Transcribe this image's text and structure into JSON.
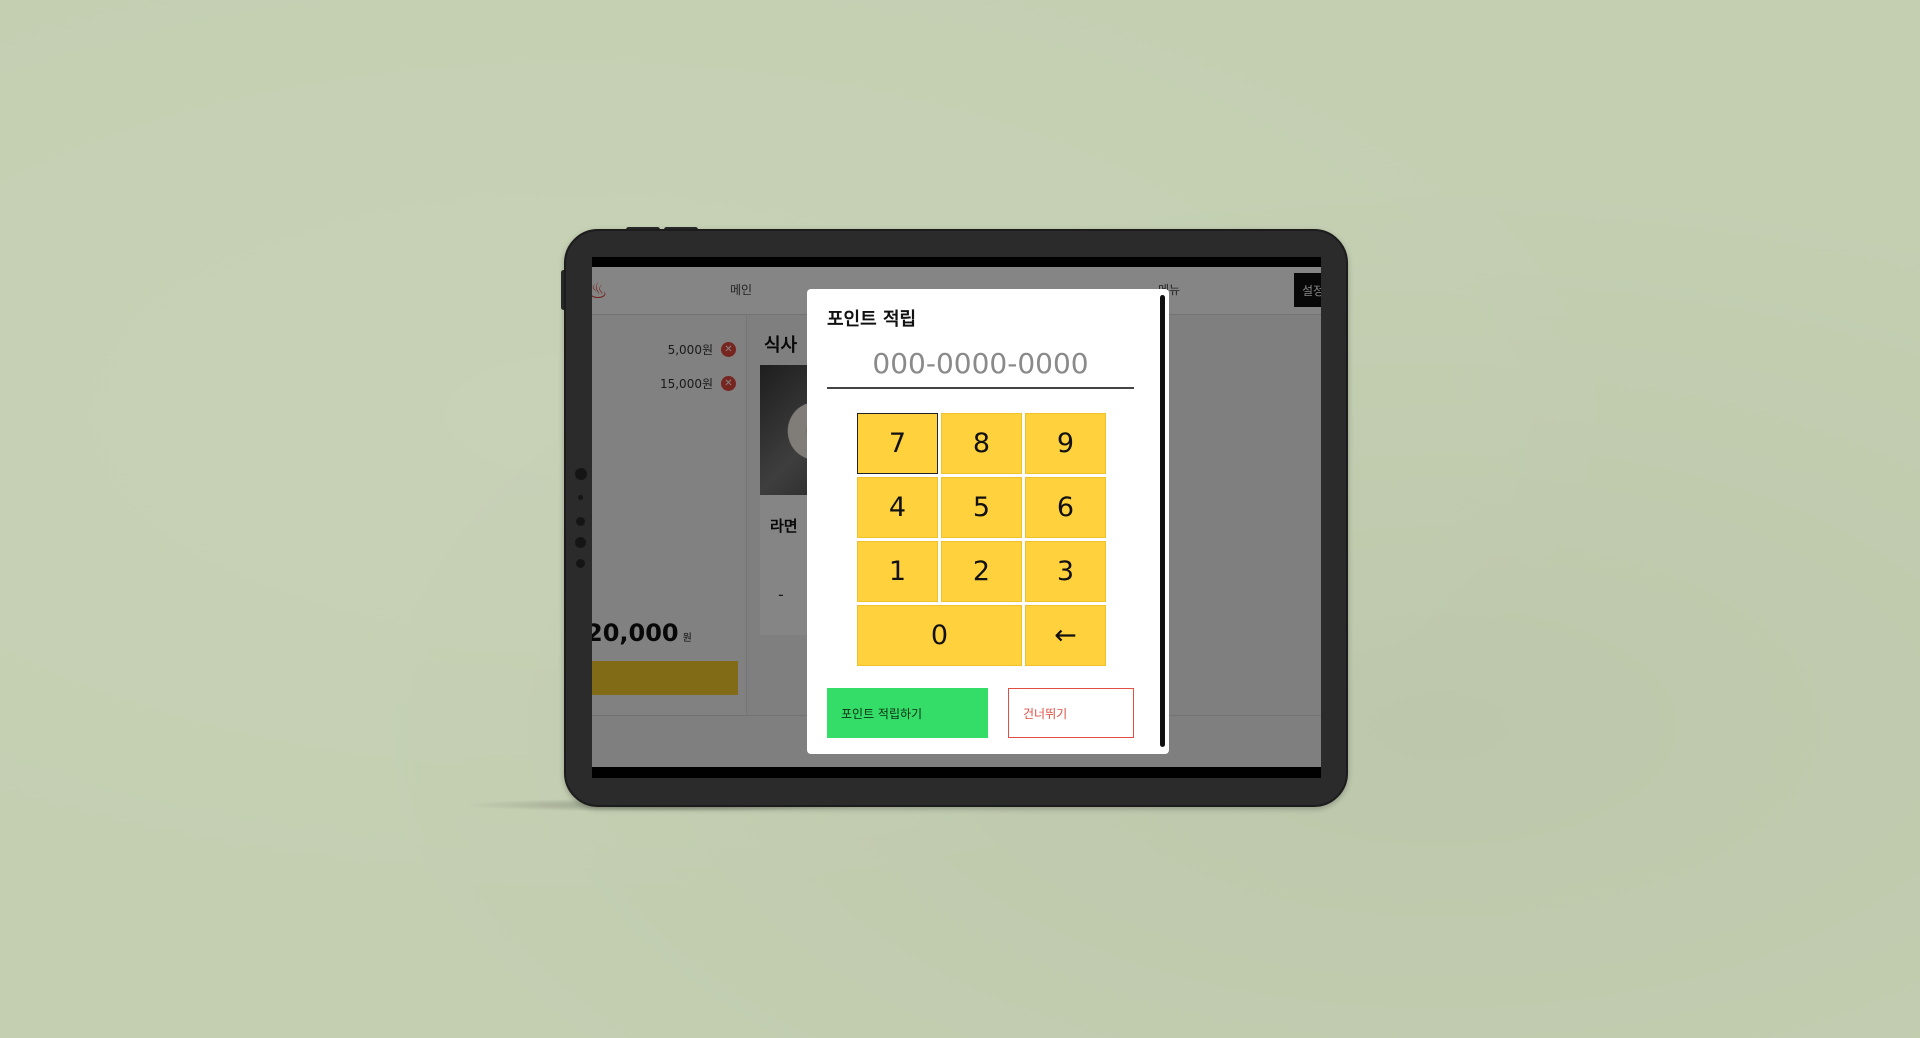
{
  "app": {
    "nav_main": "메인",
    "nav_menu": "메뉴",
    "settings_label": "설정"
  },
  "cart": {
    "items": [
      {
        "price": "5,000원"
      },
      {
        "price": "15,000원"
      }
    ],
    "total_amount": "20,000",
    "total_unit": "원"
  },
  "menu": {
    "category_title": "식사",
    "item_name": "라면",
    "minus_label": "-"
  },
  "modal": {
    "title": "포인트 적립",
    "phone_placeholder": "000-0000-0000",
    "keys": [
      "7",
      "8",
      "9",
      "4",
      "5",
      "6",
      "1",
      "2",
      "3",
      "0",
      "←"
    ],
    "earn_button": "포인트 적립하기",
    "skip_button": "건너뛰기"
  },
  "colors": {
    "background": "#c4cfb2",
    "key_yellow": "#fed13d",
    "earn_green": "#34dd67",
    "skip_red": "#e04f43",
    "delete_red": "#e5483d"
  },
  "icons": {
    "delete": "close-circle-icon",
    "backspace": "arrow-left-icon",
    "logo": "restaurant-logo-icon"
  }
}
